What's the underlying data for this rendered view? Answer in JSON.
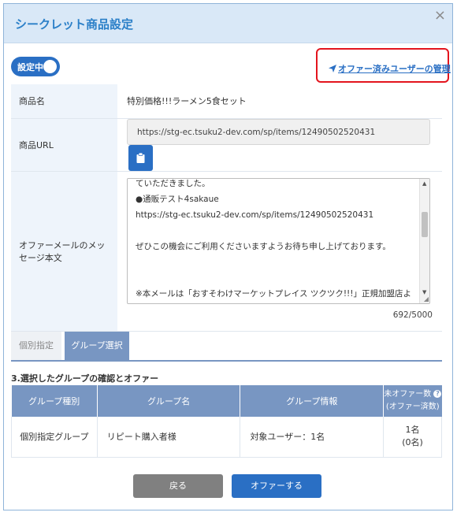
{
  "header": {
    "title": "シークレット商品設定",
    "close_glyph": "×"
  },
  "toggle": {
    "label": "設定中"
  },
  "offer_link": {
    "label": "オファー済みユーザーの管理",
    "icon": "send-icon"
  },
  "form": {
    "product_name_label": "商品名",
    "product_name_value": "特別価格!!!ラーメン5食セット",
    "product_url_label": "商品URL",
    "product_url_value": "https://stg-ec.tsuku2-dev.com/sp/items/12490502520431",
    "copy_icon": "clipboard-icon",
    "message_label": "オファーメールのメッセージ本文",
    "message_lines": [
      "ていただきました。",
      "●通販テスト4sakaue",
      "https://stg-ec.tsuku2-dev.com/sp/items/12490502520431",
      "",
      "ぜひこの機会にご利用くださいますようお待ち申し上げております。",
      "",
      "",
      "※本メールは「おすそわけマーケットプレイス ツクツク!!!」正規加盟店よ"
    ],
    "char_count": "692/5000"
  },
  "tabs": {
    "individual": "個別指定",
    "group": "グループ選択"
  },
  "section_title": "3.選択したグループの確認とオファー",
  "group_table": {
    "headers": {
      "type": "グループ種別",
      "name": "グループ名",
      "info": "グループ情報",
      "count_line1": "未オファー数",
      "count_line2": "(オファー済数)"
    },
    "rows": [
      {
        "type": "個別指定グループ",
        "name": "リピート購入者様",
        "info": "対象ユーザー：1名",
        "count": "1名",
        "offered": "(0名)"
      }
    ]
  },
  "buttons": {
    "back": "戻る",
    "offer": "オファーする"
  },
  "colors": {
    "accent": "#2a6fc4",
    "header_bg": "#d9e8f7",
    "highlight": "#e3141d",
    "table_header": "#7896c2"
  }
}
